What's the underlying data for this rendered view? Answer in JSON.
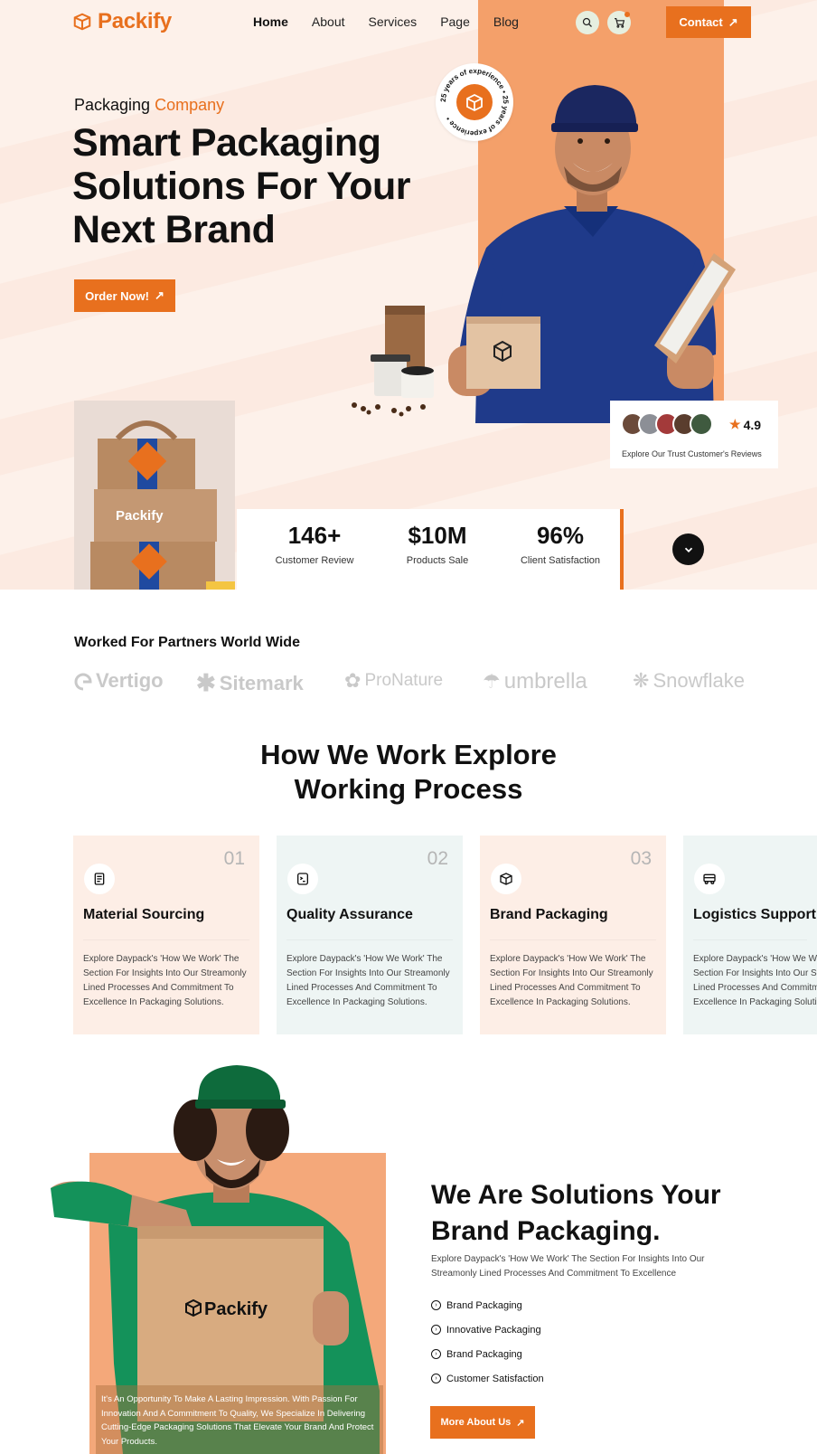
{
  "brand": {
    "name": "Packify"
  },
  "nav": {
    "items": [
      "Home",
      "About",
      "Services",
      "Page",
      "Blog"
    ],
    "contact_label": "Contact"
  },
  "hero": {
    "eyebrow": "Packaging",
    "eyebrow_accent": "Company",
    "headline": "Smart Packaging Solutions For Your Next Brand",
    "cta": "Order Now!",
    "badge_text": "25 years of experience • 25 years of experience •",
    "rating": "4.9",
    "reviews_text": "Explore Our Trust  Customer's Reviews",
    "box_brand": "Packify"
  },
  "stats": [
    {
      "value": "146+",
      "label": "Customer Review"
    },
    {
      "value": "$10M",
      "label": "Products Sale"
    },
    {
      "value": "96%",
      "label": "Client Satisfaction"
    }
  ],
  "partners": {
    "title": "Worked For Partners World Wide",
    "logos": [
      "Vertigo",
      "Sitemark",
      "ProNature",
      "umbrella",
      "Snowflake"
    ]
  },
  "process": {
    "title_line1": "How We Work Explore",
    "title_line2": "Working Process",
    "cards": [
      {
        "num": "01",
        "title": "Material Sourcing",
        "text": "Explore Daypack's 'How We Work' The Section For Insights Into Our Streamonly Lined Processes And Commitment To Excellence In Packaging Solutions.",
        "icon": "document-icon"
      },
      {
        "num": "02",
        "title": "Quality Assurance",
        "text": "Explore Daypack's 'How We Work' The Section For Insights Into Our Streamonly Lined Processes And Commitment To Excellence In Packaging Solutions.",
        "icon": "checklist-icon"
      },
      {
        "num": "03",
        "title": "Brand Packaging",
        "text": "Explore Daypack's 'How We Work' The Section For Insights Into Our Streamonly Lined Processes And Commitment To Excellence In Packaging Solutions.",
        "icon": "box-icon"
      },
      {
        "num": "",
        "title": "Logistics Support",
        "text": "Explore Daypack's 'How We Work' The Section For Insights Into Our Streamonly Lined Processes And Commitment To Excellence In Packaging Solutions.",
        "icon": "truck-icon"
      }
    ]
  },
  "about": {
    "title": "We Are Solutions Your Brand Packaging.",
    "desc": "Explore Daypack's 'How We Work' The Section For Insights Into Our Streamonly Lined Processes And Commitment To Excellence",
    "list": [
      "Brand Packaging",
      "Innovative Packaging",
      "Brand Packaging",
      "Customer Satisfaction"
    ],
    "cta": "More About Us",
    "caption": "It's An Opportunity To Make A Lasting Impression. With  Passion For Innovation And A Commitment To Quality, We Specialize In Delivering Cutting-Edge Packaging Solutions That Elevate Your Brand And Protect Your Products.",
    "box_brand": "Packify"
  },
  "colors": {
    "accent": "#e8701e",
    "peach": "#f4a06a",
    "hero_bg": "#fdf1ea",
    "card_peach": "#fdeee6",
    "card_mint": "#eef5f4"
  }
}
